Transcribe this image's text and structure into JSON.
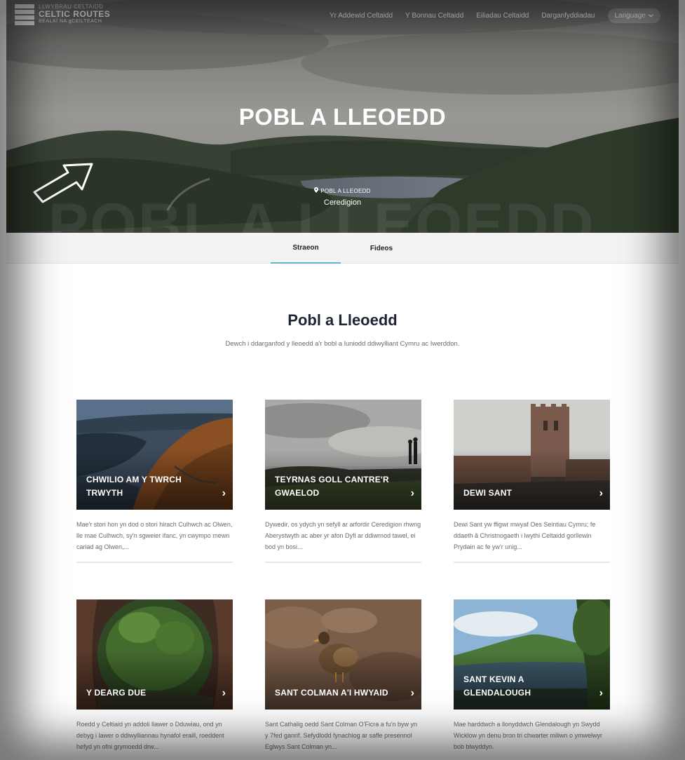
{
  "logo": {
    "top": "LLWYBRAU CELTAIDD",
    "main": "CELTIC ROUTES",
    "bottom": "BEALAÍ NA gCEILTEACH"
  },
  "nav": {
    "items": [
      "Yr Addewid Celtaidd",
      "Y Bonnau Celtaidd",
      "Eiliadau Celtaidd",
      "Darganfyddiadau"
    ],
    "language": "Language"
  },
  "hero": {
    "title": "POBL A LLEOEDD",
    "watermark": "POBL A LLEOEDD",
    "location_label": "POBL A LLEOEDD",
    "location": "Ceredigion"
  },
  "tabs": {
    "active": "Straeon",
    "other": "Fideos"
  },
  "section": {
    "title": "Pobl a Lleoedd",
    "subtitle": "Dewch i ddarganfod y lleoedd a'r bobl a luniodd ddiwylliant Cymru ac Iwerddon."
  },
  "cards": [
    {
      "title": "CHWILIO AM Y TWRCH TRWYTH",
      "text": "Mae'r stori hon yn dod o stori hirach Culhwch ac Olwen, lle mae Culhwch, sy'n sgweier ifanc, yn cwympo mewn cariad ag Olwen,..."
    },
    {
      "title": "TEYRNAS GOLL CANTRE'R GWAELOD",
      "text": "Dywedir, os ydych yn sefyll ar arfordir Ceredigion rhwng Aberystwyth ac aber yr afon Dyfi ar ddiwrnod tawel, ei bod yn bosi..."
    },
    {
      "title": "DEWI SANT",
      "text": "Dewi Sant yw ffigwr mwyaf Oes Seintiau Cymru; fe ddaeth â Christnogaeth i lwythi Celtaidd gorllewin Prydain ac fe yw'r unig..."
    },
    {
      "title": "Y DEARG DUE",
      "text": "Roedd y Celtiaid yn addoli llawer o Dduwiau, ond yn debyg i lawer o ddiwylliannau hynafol eraill, roeddent hefyd yn ofni grymoedd drw..."
    },
    {
      "title": "SANT COLMAN A'I HWYAID",
      "text": "Sant Cathalig oedd Sant Colman O'Ficra a fu'n byw yn y 7fed ganrif. Sefydlodd fynachlog ar safle presennol Eglwys Sant Colman yn..."
    },
    {
      "title": "SANT KEVIN A GLENDALOUGH",
      "text": "Mae harddwch a llonyddwch Glendalough yn Swydd Wicklow yn denu bron tri chwarter miliwn o ymwelwyr bob blwyddyn."
    }
  ],
  "icons": {
    "chevron": "chevron-right-icon",
    "pin": "map-pin-icon",
    "arrow": "pointer-arrow-icon"
  },
  "colors": {
    "tab_accent": "#5fb2d0",
    "heading": "#1d2433"
  }
}
